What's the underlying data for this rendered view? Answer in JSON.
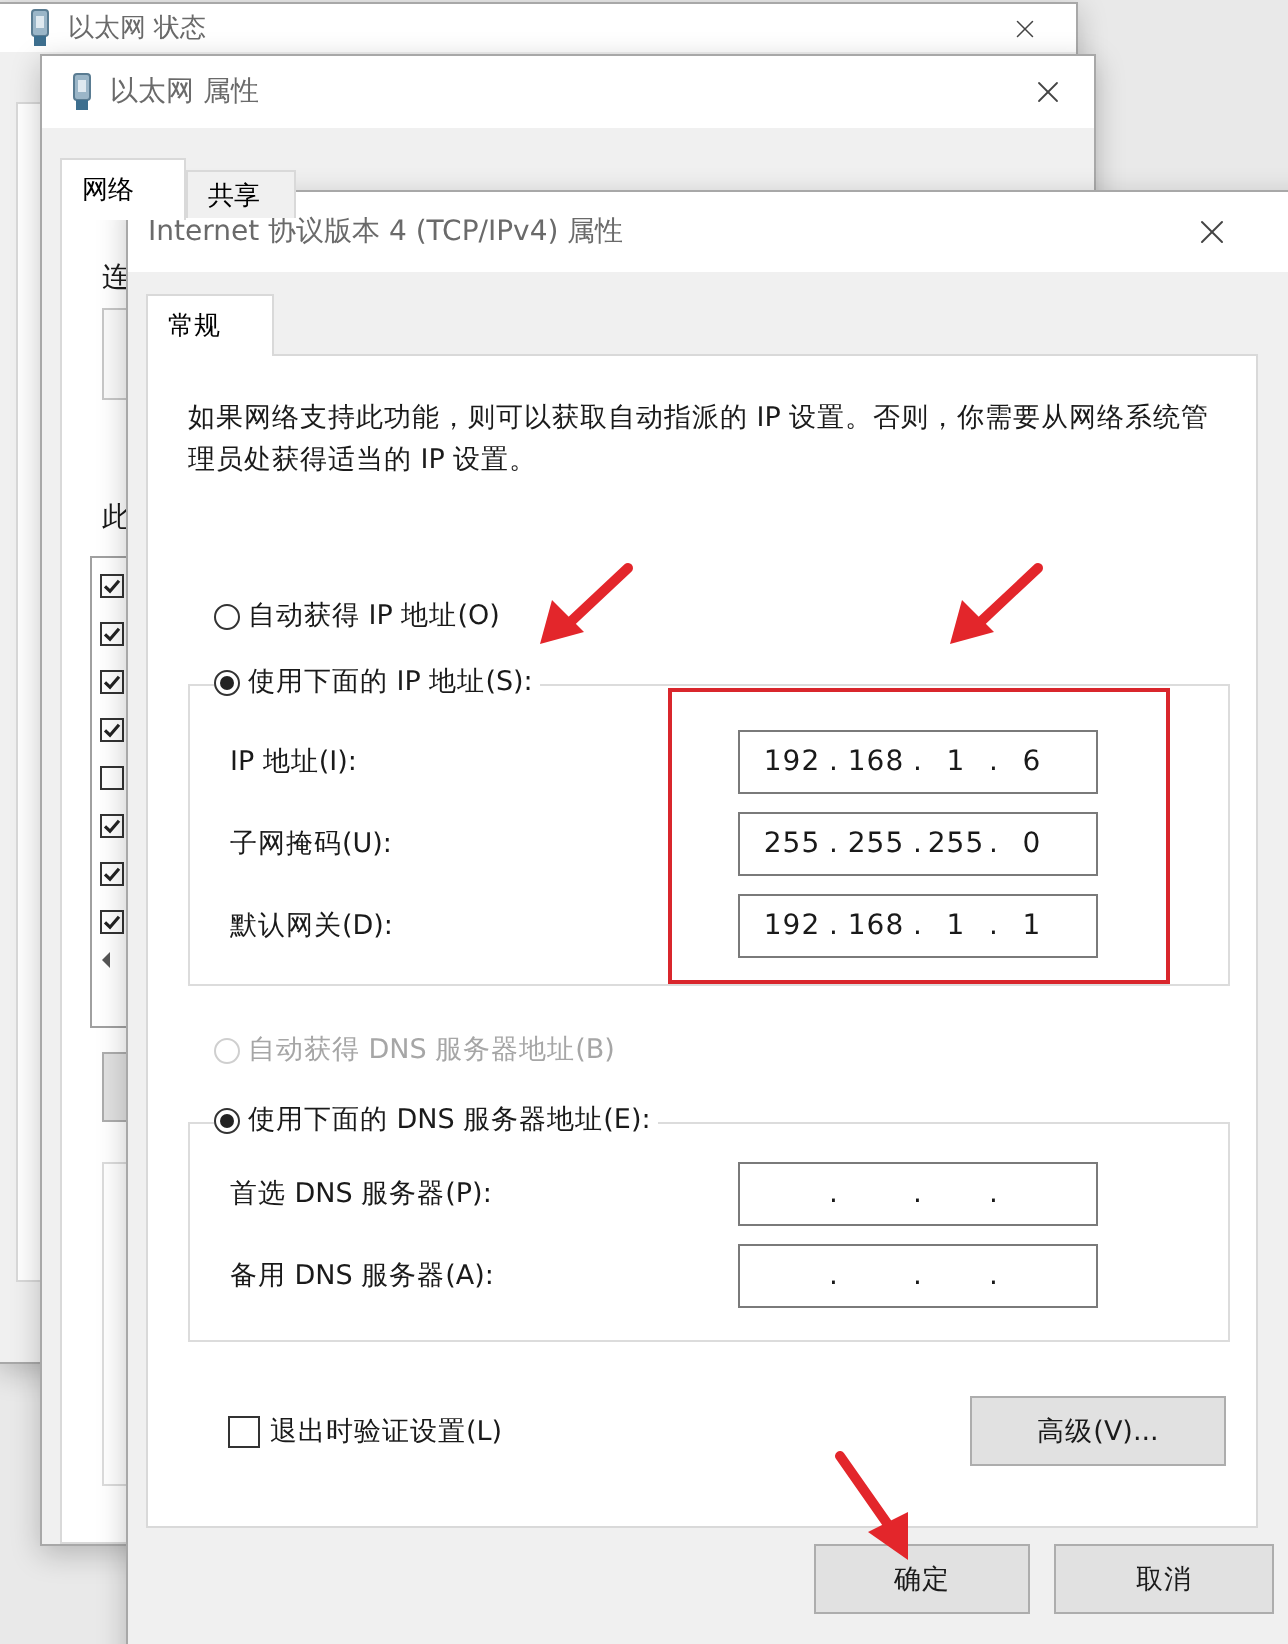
{
  "status_window": {
    "title": "以太网 状态"
  },
  "properties_window": {
    "title": "以太网 属性",
    "tabs": [
      {
        "label": "网络",
        "selected": true
      },
      {
        "label": "共享",
        "selected": false
      }
    ],
    "connect_label": "连",
    "items_label": "此",
    "components": [
      {
        "checked": true
      },
      {
        "checked": true
      },
      {
        "checked": true
      },
      {
        "checked": true
      },
      {
        "checked": false
      },
      {
        "checked": true
      },
      {
        "checked": true
      },
      {
        "checked": true
      }
    ]
  },
  "ipv4_dialog": {
    "title": "Internet 协议版本 4 (TCP/IPv4) 属性",
    "tabs": [
      {
        "label": "常规",
        "selected": true
      }
    ],
    "description": "如果网络支持此功能，则可以获取自动指派的 IP 设置。否则，你需要从网络系统管理员处获得适当的 IP 设置。",
    "ip_options": [
      {
        "label": "自动获得 IP 地址(O)",
        "selected": false,
        "disabled": false
      },
      {
        "label": "使用下面的 IP 地址(S):",
        "selected": true,
        "disabled": false
      }
    ],
    "ip_fields": [
      {
        "label": "IP 地址(I):",
        "value": "192 . 168 . 1 . 6"
      },
      {
        "label": "子网掩码(U):",
        "value": "255 . 255 . 255 . 0"
      },
      {
        "label": "默认网关(D):",
        "value": "192 . 168 . 1 . 1"
      }
    ],
    "dns_options": [
      {
        "label": "自动获得 DNS 服务器地址(B)",
        "selected": false,
        "disabled": true
      },
      {
        "label": "使用下面的 DNS 服务器地址(E):",
        "selected": true,
        "disabled": false
      }
    ],
    "dns_fields": [
      {
        "label": "首选 DNS 服务器(P):",
        "value": ". . ."
      },
      {
        "label": "备用 DNS 服务器(A):",
        "value": ". . ."
      }
    ],
    "validate_checkbox": {
      "label": "退出时验证设置(L)",
      "checked": false
    },
    "advanced_button": "高级(V)...",
    "buttons": [
      "确定",
      "取消"
    ]
  }
}
